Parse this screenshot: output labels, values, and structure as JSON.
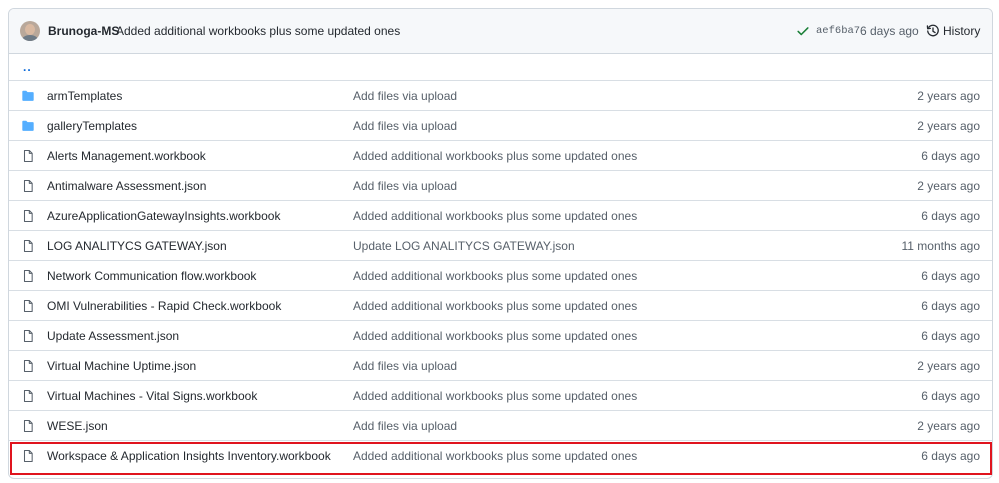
{
  "latest_commit": {
    "author": "Brunoga-MS",
    "message": "Added additional workbooks plus some updated ones",
    "sha": "aef6ba7",
    "time": "6 days ago",
    "history_label": "History"
  },
  "parent_dir": "..",
  "files": [
    {
      "type": "folder",
      "icon": "folder-icon",
      "name": "armTemplates",
      "message": "Add files via upload",
      "age": "2 years ago"
    },
    {
      "type": "folder",
      "icon": "folder-icon",
      "name": "galleryTemplates",
      "message": "Add files via upload",
      "age": "2 years ago"
    },
    {
      "type": "file",
      "icon": "file-icon",
      "name": "Alerts Management.workbook",
      "message": "Added additional workbooks plus some updated ones",
      "age": "6 days ago"
    },
    {
      "type": "file",
      "icon": "file-icon",
      "name": "Antimalware Assessment.json",
      "message": "Add files via upload",
      "age": "2 years ago"
    },
    {
      "type": "file",
      "icon": "file-icon",
      "name": "AzureApplicationGatewayInsights.workbook",
      "message": "Added additional workbooks plus some updated ones",
      "age": "6 days ago"
    },
    {
      "type": "file",
      "icon": "file-icon",
      "name": "LOG ANALITYCS GATEWAY.json",
      "message": "Update LOG ANALITYCS GATEWAY.json",
      "age": "11 months ago"
    },
    {
      "type": "file",
      "icon": "file-icon",
      "name": "Network Communication flow.workbook",
      "message": "Added additional workbooks plus some updated ones",
      "age": "6 days ago"
    },
    {
      "type": "file",
      "icon": "file-icon",
      "name": "OMI Vulnerabilities - Rapid Check.workbook",
      "message": "Added additional workbooks plus some updated ones",
      "age": "6 days ago"
    },
    {
      "type": "file",
      "icon": "file-icon",
      "name": "Update Assessment.json",
      "message": "Added additional workbooks plus some updated ones",
      "age": "6 days ago"
    },
    {
      "type": "file",
      "icon": "file-icon",
      "name": "Virtual Machine Uptime.json",
      "message": "Add files via upload",
      "age": "2 years ago"
    },
    {
      "type": "file",
      "icon": "file-icon",
      "name": "Virtual Machines - Vital Signs.workbook",
      "message": "Added additional workbooks plus some updated ones",
      "age": "6 days ago"
    },
    {
      "type": "file",
      "icon": "file-icon",
      "name": "WESE.json",
      "message": "Add files via upload",
      "age": "2 years ago"
    },
    {
      "type": "file",
      "icon": "file-icon",
      "name": "Workspace & Application Insights Inventory.workbook",
      "message": "Added additional workbooks plus some updated ones",
      "age": "6 days ago"
    }
  ],
  "colors": {
    "folder": "#54aeff",
    "file": "#57606a",
    "link": "#0969da",
    "check": "#1a7f37",
    "highlight": "#e0141e",
    "border": "#d0d7de",
    "header_bg": "#f6f8fa"
  }
}
